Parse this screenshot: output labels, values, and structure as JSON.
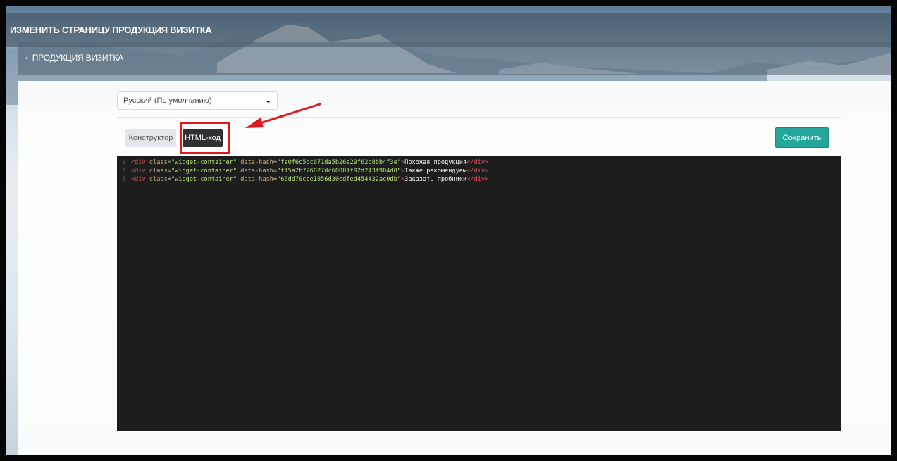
{
  "header": {
    "title": "ИЗМЕНИТЬ СТРАНИЦУ ПРОДУКЦИЯ ВИЗИТКА"
  },
  "breadcrumb": {
    "back_icon": "chevron-left-icon",
    "back_label": "ПРОДУКЦИЯ ВИЗИТКА"
  },
  "language_select": {
    "selected": "Русский (По умолчанию)",
    "icon": "chevron-down-icon"
  },
  "tabs": [
    {
      "label": "Конструктор",
      "active": false
    },
    {
      "label": "HTML-код",
      "active": true
    }
  ],
  "save_button": {
    "label": "Сохранить",
    "color": "#24a79a"
  },
  "annotation": {
    "highlight_color": "#e2161d",
    "target": "HTML-код"
  },
  "editor": {
    "lines": [
      {
        "number": "1",
        "class_value": "\"widget-container\"",
        "hash_value": "\"fa0f6c5bc671da5b26e29f62b8bb4f3e\"",
        "text": "Похожая продукция"
      },
      {
        "number": "2",
        "class_value": "\"widget-container\"",
        "hash_value": "\"f15a2b726027dc60001f92d243f904d0\"",
        "text": "Также рекомендуем"
      },
      {
        "number": "3",
        "class_value": "\"widget-container\"",
        "hash_value": "\"66dd70cce1856d30edfed454432ac0db\"",
        "text": "Заказать пробники"
      }
    ],
    "open_tag": "<div",
    "class_attr": "class",
    "hash_attr": "data-hash",
    "close_tag": "</div>"
  }
}
